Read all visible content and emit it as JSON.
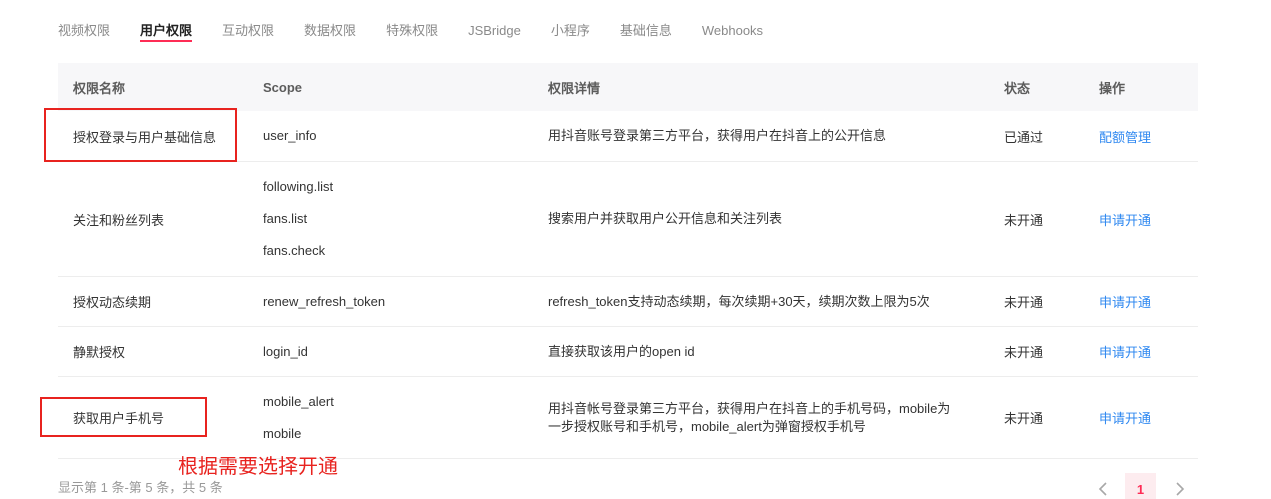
{
  "tabs": [
    {
      "label": "视频权限"
    },
    {
      "label": "用户权限",
      "active": true
    },
    {
      "label": "互动权限"
    },
    {
      "label": "数据权限"
    },
    {
      "label": "特殊权限"
    },
    {
      "label": "JSBridge"
    },
    {
      "label": "小程序"
    },
    {
      "label": "基础信息"
    },
    {
      "label": "Webhooks"
    }
  ],
  "table": {
    "columns": [
      "权限名称",
      "Scope",
      "权限详情",
      "状态",
      "操作"
    ],
    "rows": [
      {
        "name": "授权登录与用户基础信息",
        "scopes": [
          "user_info"
        ],
        "detail": [
          "用抖音账号登录第三方平台，获得用户在抖音上的公开信息"
        ],
        "status": "已通过",
        "action": "配额管理"
      },
      {
        "name": "关注和粉丝列表",
        "scopes": [
          "following.list",
          "fans.list",
          "fans.check"
        ],
        "detail": [
          "搜索用户并获取用户公开信息和关注列表"
        ],
        "status": "未开通",
        "action": "申请开通"
      },
      {
        "name": "授权动态续期",
        "scopes": [
          "renew_refresh_token"
        ],
        "detail": [
          "refresh_token支持动态续期，每次续期+30天，续期次数上限为5次"
        ],
        "status": "未开通",
        "action": "申请开通"
      },
      {
        "name": "静默授权",
        "scopes": [
          "login_id"
        ],
        "detail": [
          "直接获取该用户的open id"
        ],
        "status": "未开通",
        "action": "申请开通"
      },
      {
        "name": "获取用户手机号",
        "scopes": [
          "mobile_alert",
          "mobile"
        ],
        "detail": [
          "用抖音帐号登录第三方平台，获得用户在抖音上的手机号码，mobile为",
          "一步授权账号和手机号，mobile_alert为弹窗授权手机号"
        ],
        "status": "未开通",
        "action": "申请开通"
      }
    ]
  },
  "annotation": {
    "note": "根据需要选择开通"
  },
  "footer": {
    "summary": "显示第 1 条-第 5 条，共 5 条"
  },
  "pagination": {
    "current_page": "1",
    "prev_icon": "chevron-left-icon",
    "next_icon": "chevron-right-icon"
  },
  "colors": {
    "accent": "#fe2c55",
    "link": "#2f88f0",
    "annotation": "#e8231f",
    "text": "#333333",
    "muted": "#999999",
    "tab_inactive": "#8a8a8a",
    "header_bg": "#f7f7f9",
    "border": "#ededed",
    "page_active_bg": "#fdecef"
  }
}
